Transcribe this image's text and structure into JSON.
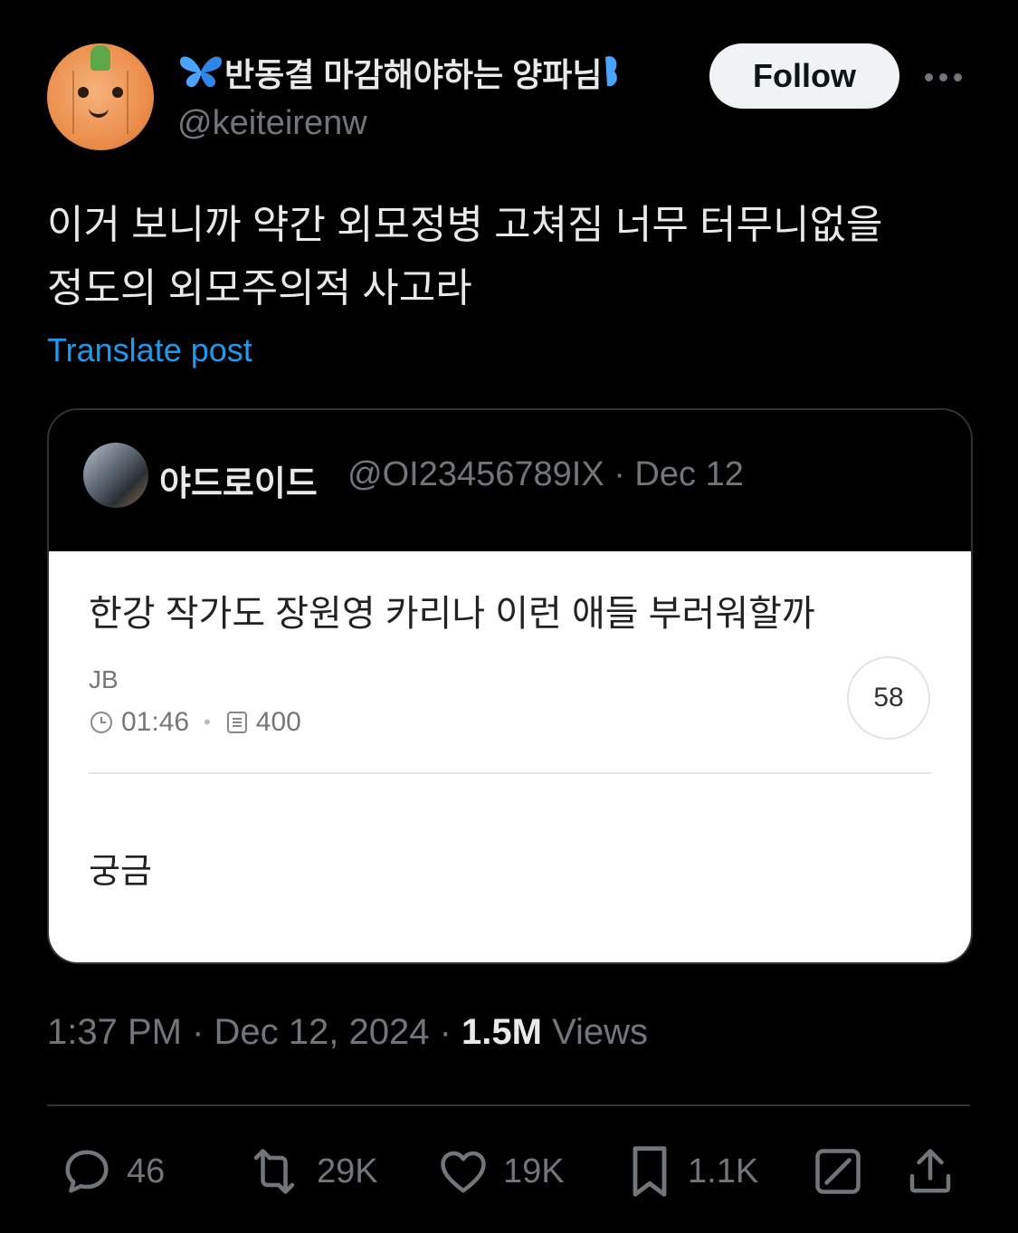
{
  "author": {
    "display_name": "반동결 마감해야하는 양파님",
    "handle": "@keiteirenw",
    "follow_label": "Follow"
  },
  "tweet": {
    "text": "이거 보니까 약간 외모정병 고쳐짐 너무 터무니없을\n정도의 외모주의적 사고라",
    "translate_label": "Translate post"
  },
  "quote": {
    "name": "야드로이드",
    "meta": "@OI23456789IX · Dec 12",
    "post": {
      "title": "한강 작가도 장원영 카리나 이런 애들 부러워할까",
      "author": "JB",
      "time": "01:46",
      "views": "400",
      "comment_count": "58",
      "body": "궁금"
    }
  },
  "timestamp": {
    "time_date": "1:37 PM · Dec 12, 2024 · ",
    "views_count": "1.5M",
    "views_label": " Views"
  },
  "actions": {
    "replies": "46",
    "reposts": "29K",
    "likes": "19K",
    "bookmarks": "1.1K"
  },
  "colors": {
    "accent": "#1d9bf0",
    "muted": "#71767b",
    "butterfly": "#4aa3ff"
  },
  "icons": [
    "butterfly-icon",
    "more-icon",
    "clock-icon",
    "document-icon",
    "reply-icon",
    "repost-icon",
    "like-icon",
    "bookmark-icon",
    "grok-icon",
    "share-icon"
  ]
}
